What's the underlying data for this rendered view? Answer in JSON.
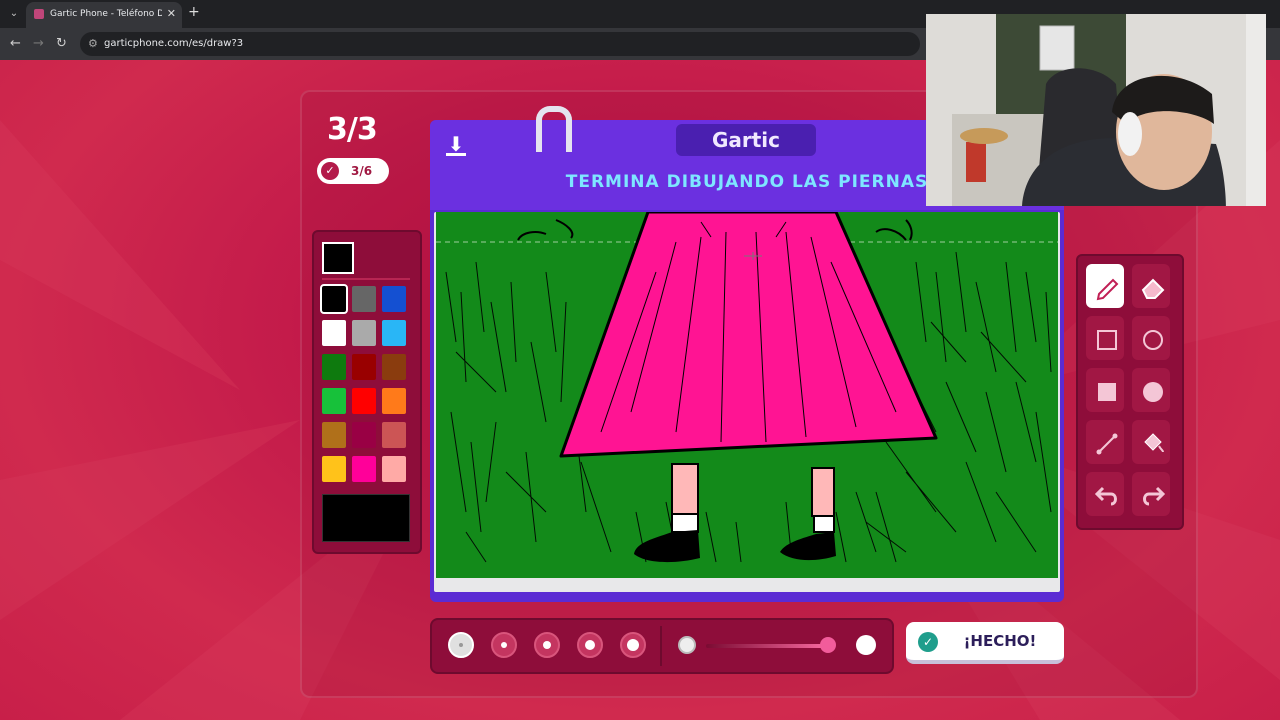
{
  "browser": {
    "tab_title": "Gartic Phone - Teléfono Descon",
    "url": "garticphone.com/es/draw?3"
  },
  "game": {
    "round": "3/3",
    "done_count": "3/6",
    "logo": "Gartic",
    "prompt": "TERMINA DIBUJANDO LAS PIERNAS",
    "done_button": "¡HECHO!"
  },
  "palette": {
    "selected_color": "#000000",
    "colors": [
      {
        "name": "black",
        "hex": "#000000"
      },
      {
        "name": "dark-gray",
        "hex": "#666666"
      },
      {
        "name": "blue",
        "hex": "#1450d2"
      },
      {
        "name": "white",
        "hex": "#ffffff"
      },
      {
        "name": "light-gray",
        "hex": "#aaaaaa"
      },
      {
        "name": "cyan",
        "hex": "#29b6f6"
      },
      {
        "name": "dark-green",
        "hex": "#0e7a0e"
      },
      {
        "name": "dark-red",
        "hex": "#990000"
      },
      {
        "name": "brown",
        "hex": "#8a3c0e"
      },
      {
        "name": "green",
        "hex": "#17c13a"
      },
      {
        "name": "red",
        "hex": "#ff0000"
      },
      {
        "name": "orange",
        "hex": "#ff7a1a"
      },
      {
        "name": "ochre",
        "hex": "#b0701a"
      },
      {
        "name": "maroon",
        "hex": "#990044"
      },
      {
        "name": "rose",
        "hex": "#cc5555"
      },
      {
        "name": "yellow",
        "hex": "#ffc21a"
      },
      {
        "name": "magenta",
        "hex": "#ff0099"
      },
      {
        "name": "pink",
        "hex": "#ffaaa6"
      }
    ]
  },
  "tools": [
    {
      "name": "pencil-icon",
      "selected": true
    },
    {
      "name": "eraser-icon",
      "selected": false
    },
    {
      "name": "rectangle-outline-icon",
      "selected": false
    },
    {
      "name": "ellipse-outline-icon",
      "selected": false
    },
    {
      "name": "rectangle-filled-icon",
      "selected": false
    },
    {
      "name": "ellipse-filled-icon",
      "selected": false
    },
    {
      "name": "line-icon",
      "selected": false
    },
    {
      "name": "fill-bucket-icon",
      "selected": false
    },
    {
      "name": "undo-icon",
      "selected": false
    },
    {
      "name": "redo-icon",
      "selected": false
    }
  ],
  "brush": {
    "sizes": [
      1,
      2,
      3,
      4,
      5
    ],
    "selected_size": 1,
    "opacity_fraction": 0.95
  },
  "theme": {
    "board_purple": "#6b30e0",
    "prompt_cyan": "#7ee6ff",
    "grass_green": "#138a1a",
    "dress_pink": "#ff1493"
  }
}
